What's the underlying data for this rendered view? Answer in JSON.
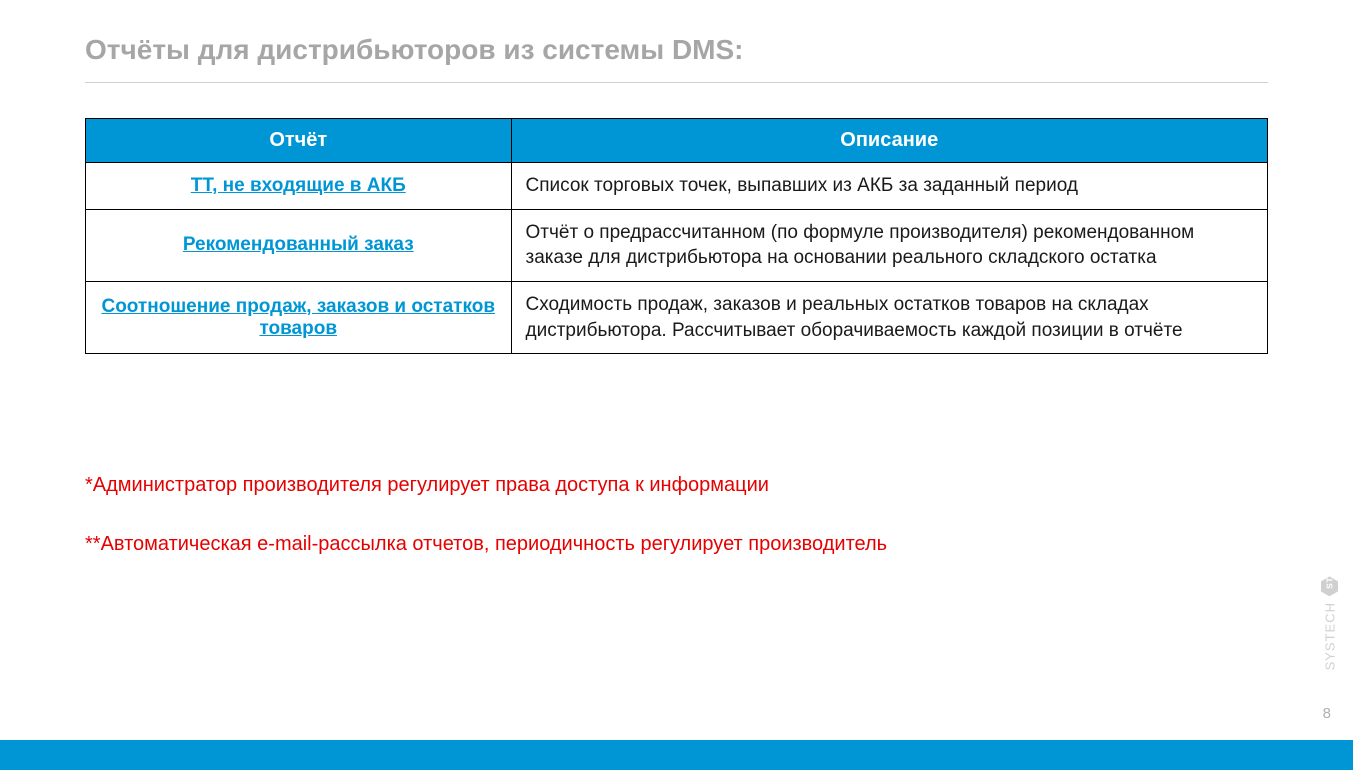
{
  "title": "Отчёты для дистрибьюторов из системы DMS:",
  "table": {
    "headers": [
      "Отчёт",
      "Описание"
    ],
    "rows": [
      {
        "name": "ТТ, не входящие в АКБ",
        "desc": "Список торговых точек, выпавших из АКБ за заданный период"
      },
      {
        "name": "Рекомендованный заказ",
        "desc": "Отчёт о предрассчитанном (по формуле производителя) рекомендованном заказе для дистрибьютора на основании реального складского остатка"
      },
      {
        "name": "Соотношение продаж, заказов и остатков товаров",
        "desc": "Сходимость продаж, заказов и реальных остатков товаров на складах дистрибьютора. Рассчитывает оборачиваемость каждой позиции в отчёте"
      }
    ]
  },
  "notes": [
    "*Администратор производителя регулирует права доступа к информации",
    "**Автоматическая e-mail-рассылка отчетов, периодичность регулирует производитель"
  ],
  "pageNumber": "8",
  "watermark": "SYSTECH"
}
